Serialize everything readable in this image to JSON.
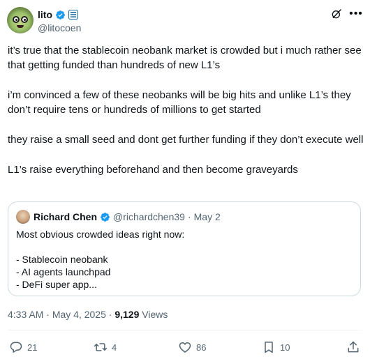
{
  "author": {
    "display_name": "lito",
    "handle": "@litocoen",
    "verified_icon": "verified-badge-icon",
    "affiliation_icon": "affiliation-badge-icon"
  },
  "header_actions": {
    "grok_icon": "grok-icon",
    "more_icon": "more-icon"
  },
  "tweet": {
    "paragraphs": [
      "it’s true that the stablecoin neobank market is crowded but i much rather see that getting funded than hundreds of new L1’s",
      "i’m convinced a few of these neobanks will be big hits and unlike L1’s they don’t require tens or hundreds of millions to get started",
      "they raise a small seed and dont get further funding if they don’t execute well",
      "L1’s raise everything beforehand and then become graveyards"
    ]
  },
  "quote": {
    "display_name": "Richard Chen",
    "handle": "@richardchen39",
    "separator": "·",
    "date": "May 2",
    "intro": "Most obvious crowded ideas right now:",
    "items": [
      "- Stablecoin neobank",
      "- AI agents launchpad",
      "- DeFi super app..."
    ]
  },
  "meta": {
    "time": "4:33 AM",
    "sep1": "·",
    "date": "May 4, 2025",
    "sep2": "·",
    "views_count": "9,129",
    "views_label": "Views"
  },
  "actions": {
    "reply_count": "21",
    "repost_count": "4",
    "like_count": "86",
    "bookmark_count": "10"
  },
  "colors": {
    "text_primary": "#0f1419",
    "text_secondary": "#536471",
    "verified_blue": "#1d9bf0",
    "border": "#cfd9de"
  }
}
